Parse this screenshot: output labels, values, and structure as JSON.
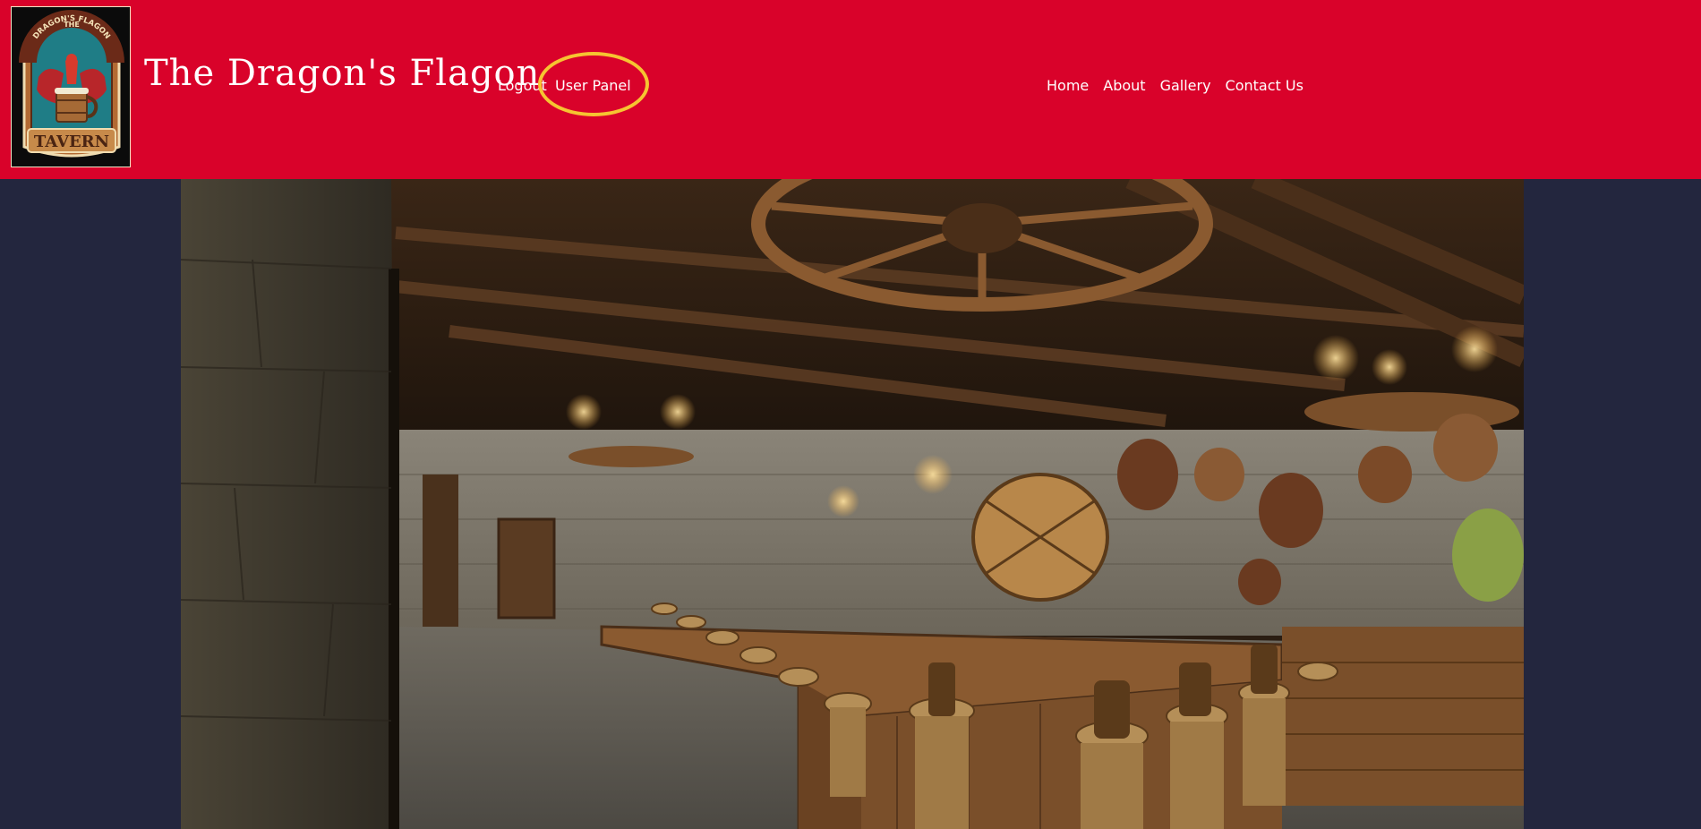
{
  "site": {
    "title": "The Dragon's Flagon"
  },
  "logo": {
    "line1": "THE",
    "line2": "DRAGON'S FLAGON",
    "banner": "TAVERN",
    "icon": "dragon-tankard-logo-icon"
  },
  "account_nav": {
    "logout": "Logout",
    "user_panel": "User Panel"
  },
  "main_nav": [
    {
      "label": "Home"
    },
    {
      "label": "About"
    },
    {
      "label": "Gallery"
    },
    {
      "label": "Contact Us"
    }
  ],
  "hero": {
    "icon": "tavern-interior-photo"
  },
  "colors": {
    "header_bg": "#d9022a",
    "page_bg": "#23263e",
    "highlight_ring": "#f6c431",
    "text": "#ffffff"
  }
}
